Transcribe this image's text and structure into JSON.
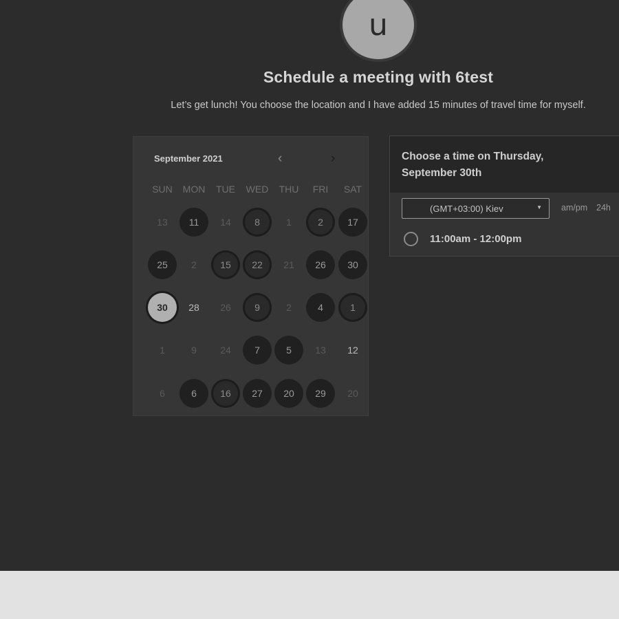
{
  "header": {
    "avatar_letter": "u",
    "title": "Schedule a meeting with 6test",
    "description": "Let’s get lunch! You choose the location and I have added 15 minutes of travel time for myself."
  },
  "calendar": {
    "month_label": "September 2021",
    "prev_icon": "‹",
    "next_icon": "›",
    "weekdays": [
      "SUN",
      "MON",
      "TUE",
      "WED",
      "THU",
      "FRI",
      "SAT"
    ],
    "weeks": [
      [
        {
          "d": "13",
          "s": "dim"
        },
        {
          "d": "11",
          "s": "avail"
        },
        {
          "d": "14",
          "s": "dim"
        },
        {
          "d": "8",
          "s": "pattern"
        },
        {
          "d": "1",
          "s": "dim"
        },
        {
          "d": "2",
          "s": "pattern"
        },
        {
          "d": "17",
          "s": "avail"
        }
      ],
      [
        {
          "d": "25",
          "s": "avail"
        },
        {
          "d": "2",
          "s": "dim"
        },
        {
          "d": "15",
          "s": "pattern"
        },
        {
          "d": "22",
          "s": "pattern"
        },
        {
          "d": "21",
          "s": "dim"
        },
        {
          "d": "26",
          "s": "avail"
        },
        {
          "d": "30",
          "s": "avail"
        }
      ],
      [
        {
          "d": "30",
          "s": "selected"
        },
        {
          "d": "28",
          "s": "light"
        },
        {
          "d": "26",
          "s": "dim"
        },
        {
          "d": "9",
          "s": "pattern"
        },
        {
          "d": "2",
          "s": "dim"
        },
        {
          "d": "4",
          "s": "avail"
        },
        {
          "d": "1",
          "s": "pattern"
        }
      ],
      [
        {
          "d": "1",
          "s": "dim"
        },
        {
          "d": "9",
          "s": "dim"
        },
        {
          "d": "24",
          "s": "dim"
        },
        {
          "d": "7",
          "s": "avail"
        },
        {
          "d": "5",
          "s": "avail"
        },
        {
          "d": "13",
          "s": "dim"
        },
        {
          "d": "12",
          "s": "light"
        }
      ],
      [
        {
          "d": "6",
          "s": "dim"
        },
        {
          "d": "6",
          "s": "avail"
        },
        {
          "d": "16",
          "s": "pattern"
        },
        {
          "d": "27",
          "s": "avail"
        },
        {
          "d": "20",
          "s": "avail"
        },
        {
          "d": "29",
          "s": "avail"
        },
        {
          "d": "20",
          "s": "dim"
        }
      ]
    ]
  },
  "time_panel": {
    "title": "Choose a time on Thursday, September 30th",
    "timezone": "(GMT+03:00) Kiev",
    "caret_icon": "▼",
    "format_ampm": "am/pm",
    "format_24h": "24h",
    "slots": [
      "11:00am - 12:00pm"
    ]
  },
  "colors": {
    "page_bg": "#2c2c2c",
    "footer_bg": "#e2e2e2",
    "selected_day": "#b0b0b0"
  }
}
